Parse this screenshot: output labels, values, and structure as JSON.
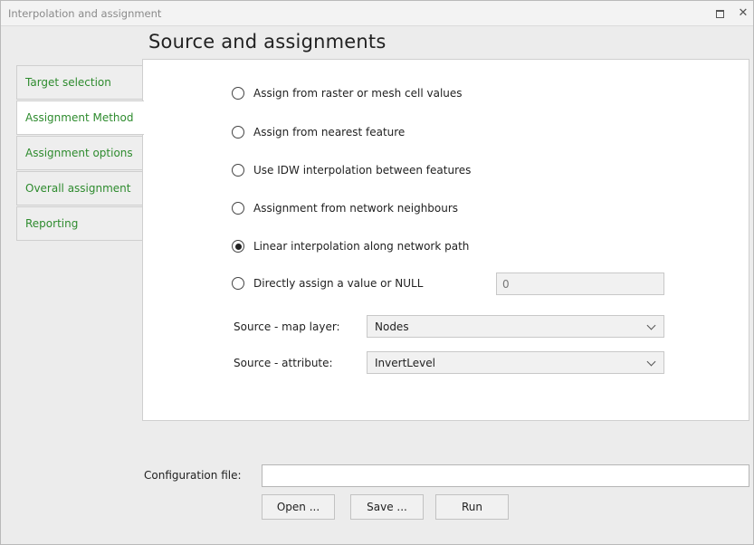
{
  "window": {
    "title": "Interpolation and assignment"
  },
  "header": {
    "title": "Source and assignments"
  },
  "tabs": [
    {
      "label": "Target selection"
    },
    {
      "label": "Assignment Method"
    },
    {
      "label": "Assignment options"
    },
    {
      "label": "Overall assignment"
    },
    {
      "label": "Reporting"
    }
  ],
  "active_tab": "Assignment Method",
  "methods": [
    {
      "label": "Assign from raster or mesh cell values",
      "checked": false
    },
    {
      "label": "Assign from nearest feature",
      "checked": false
    },
    {
      "label": "Use IDW interpolation between features",
      "checked": false
    },
    {
      "label": "Assignment from network neighbours",
      "checked": false
    },
    {
      "label": "Linear interpolation along network path",
      "checked": true
    },
    {
      "label": "Directly assign a value or NULL",
      "checked": false
    }
  ],
  "direct_value": "0",
  "source": {
    "map_layer_label": "Source - map layer:",
    "map_layer_value": "Nodes",
    "attribute_label": "Source - attribute:",
    "attribute_value": "InvertLevel"
  },
  "config": {
    "label": "Configuration file:",
    "value": ""
  },
  "buttons": {
    "open": "Open ...",
    "save": "Save ...",
    "run": "Run"
  }
}
